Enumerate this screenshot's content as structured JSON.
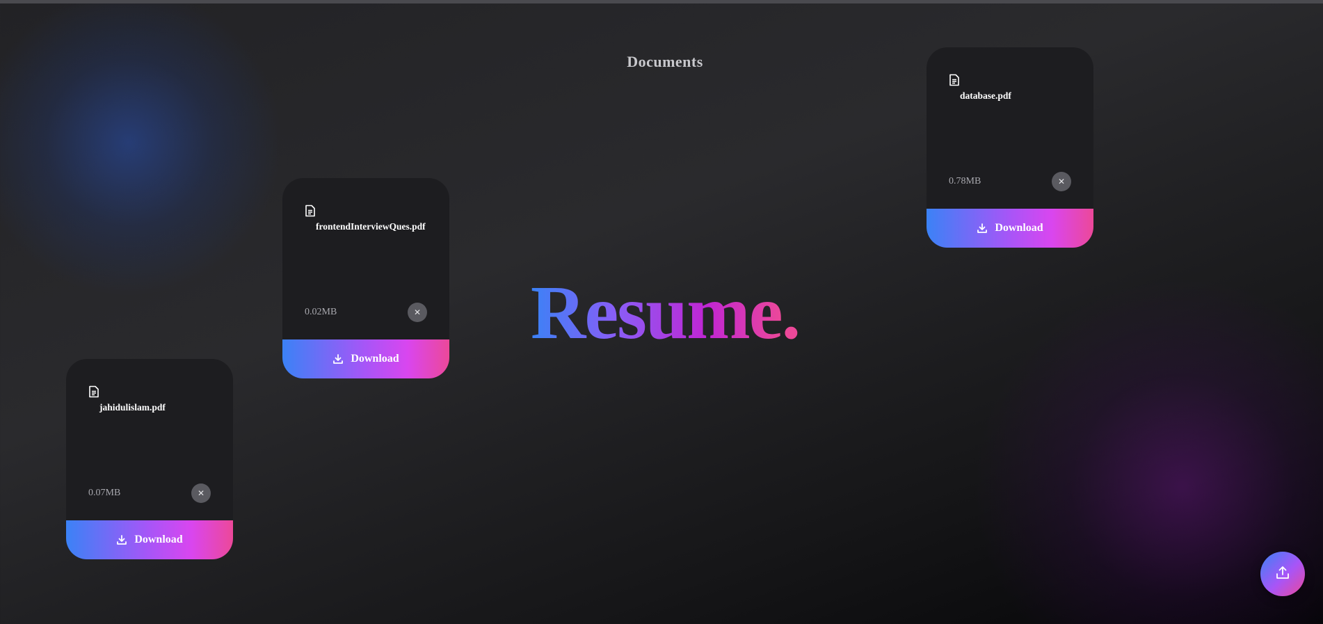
{
  "header": {
    "title": "Documents"
  },
  "hero": {
    "text": "Resume",
    "dot": "."
  },
  "documents": [
    {
      "name": "frontendInterviewQues.pdf",
      "size": "0.02MB",
      "download_label": "Download",
      "close_glyph": "✕",
      "icon": "file-icon"
    },
    {
      "name": "database.pdf",
      "size": "0.78MB",
      "download_label": "Download",
      "close_glyph": "✕",
      "icon": "file-icon"
    },
    {
      "name": "jahidulislam.pdf",
      "size": "0.07MB",
      "download_label": "Download",
      "close_glyph": "✕",
      "icon": "file-icon"
    }
  ],
  "upload_button": {
    "icon": "upload-icon"
  },
  "colors": {
    "background": "#222225",
    "card": "#1d1d20",
    "accent_blue": "#3b82f6",
    "accent_purple": "#a855f7",
    "accent_pink": "#ec4899",
    "muted_text": "#a8a8ae"
  }
}
